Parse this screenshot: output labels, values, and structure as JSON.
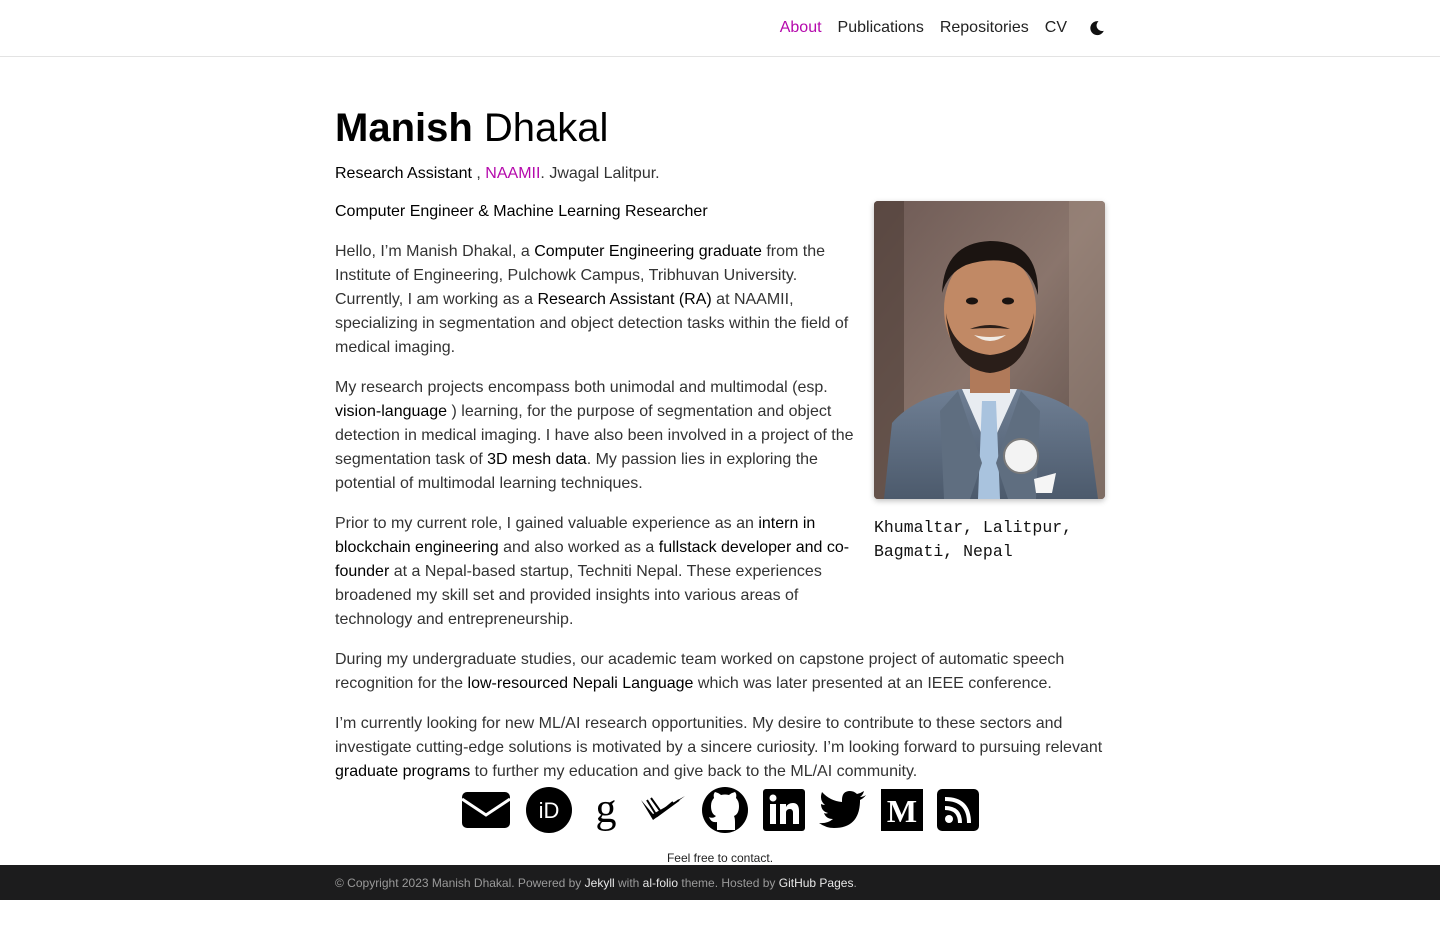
{
  "nav": {
    "items": [
      {
        "label": "About",
        "active": true
      },
      {
        "label": "Publications",
        "active": false
      },
      {
        "label": "Repositories",
        "active": false
      },
      {
        "label": "CV",
        "active": false
      }
    ],
    "theme_icon": "moon-icon"
  },
  "header": {
    "first_name": "Manish",
    "last_name": "Dhakal",
    "role": "Research Assistant",
    "separator": " , ",
    "org": "NAAMII",
    "location": ". Jwagal Lalitpur."
  },
  "profile": {
    "address_line1": "Khumaltar, Lalitpur,",
    "address_line2": "Bagmati, Nepal"
  },
  "bio": {
    "heading": "Computer Engineer & Machine Learning Researcher",
    "p1": {
      "t1": "Hello, I’m Manish Dhakal, a ",
      "b1": "Computer Engineering graduate",
      "t2": " from the Institute of Engineering, Pulchowk Campus, Tribhuvan University. Currently, I am working as a ",
      "b2": "Research Assistant (RA)",
      "t3": " at NAAMII, specializing in segmentation and object detection tasks within the field of medical imaging."
    },
    "p2": {
      "t1": "My research projects encompass both unimodal and multimodal (esp. ",
      "b1": "vision-language",
      "t2": " ) learning, for the purpose of segmentation and object detection in medical imaging. I have also been involved in a project of the segmentation task of ",
      "b2": "3D mesh data",
      "t3": ". My passion lies in exploring the potential of multimodal learning techniques."
    },
    "p3": {
      "t1": "Prior to my current role, I gained valuable experience as an ",
      "b1": "intern in blockchain engineering",
      "t2": " and also worked as a ",
      "b2": "fullstack developer and co-founder",
      "t3": " at a Nepal-based startup, Techniti Nepal. These experiences broadened my skill set and provided insights into various areas of technology and entrepreneurship."
    },
    "p4": {
      "t1": "During my undergraduate studies, our academic team worked on capstone project of automatic speech recognition for the ",
      "b1": "low-resourced Nepali Language",
      "t2": " which was later presented at an IEEE conference."
    },
    "p5": {
      "t1": "I’m currently looking for new ML/AI research opportunities. My desire to contribute to these sectors and investigate cutting-edge solutions is motivated by a sincere curiosity. I’m looking forward to pursuing relevant ",
      "b1": "graduate programs",
      "t2": " to further my education and give back to the ML/AI community."
    }
  },
  "social": {
    "icons": [
      "envelope-icon",
      "orcid-icon",
      "google-scholar-icon",
      "semantic-scholar-icon",
      "github-icon",
      "linkedin-icon",
      "twitter-icon",
      "medium-icon",
      "rss-icon"
    ],
    "note": "Feel free to contact."
  },
  "footer": {
    "t1": "© Copyright 2023 Manish Dhakal. Powered by ",
    "jekyll": "Jekyll",
    "t2": " with ",
    "alfolio": "al-folio",
    "t3": " theme. Hosted by ",
    "github_pages": "GitHub Pages",
    "t4": "."
  }
}
